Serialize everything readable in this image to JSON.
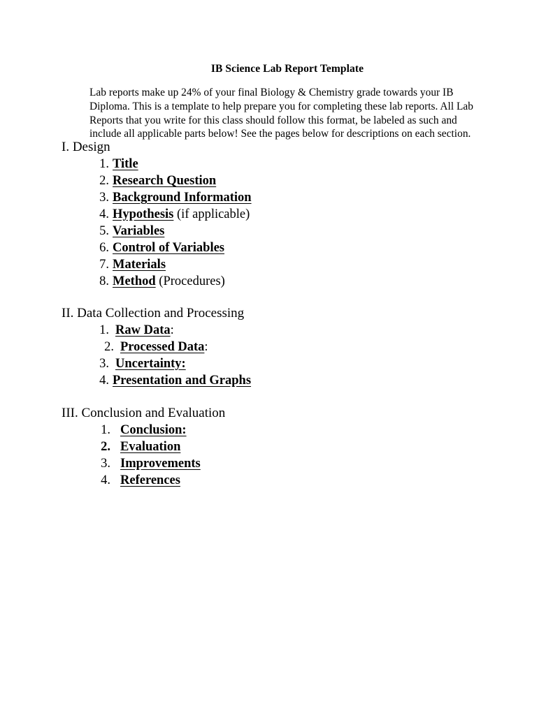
{
  "document": {
    "title": "IB Science Lab Report Template",
    "intro_paragraph": "Lab reports make up 24% of your final Biology & Chemistry grade towards your IB Diploma. This is a template to help prepare you for completing these lab reports. All Lab Reports that you write for this class should follow this format, be labeled as such and include all applicable parts below! See the pages below for descriptions on each section."
  },
  "sections": [
    {
      "heading": "I. Design",
      "items": [
        {
          "marker": "1.",
          "label": "Title",
          "suffix": ""
        },
        {
          "marker": "2.",
          "label": "Research Question",
          "suffix": ""
        },
        {
          "marker": "3.",
          "label": "Background Information",
          "suffix": ""
        },
        {
          "marker": "4.",
          "label": "Hypothesis",
          "suffix": " (if applicable)"
        },
        {
          "marker": "5.",
          "label": "Variables",
          "suffix": ""
        },
        {
          "marker": "6.",
          "label": "Control of Variables",
          "suffix": ""
        },
        {
          "marker": "7.",
          "label": "Materials",
          "suffix": ""
        },
        {
          "marker": "8.",
          "label": "Method",
          "suffix": " (Procedures)"
        }
      ]
    },
    {
      "heading": "II. Data Collection and Processing",
      "items": [
        {
          "marker": "1.",
          "label": "Raw Data",
          "suffix": ":"
        },
        {
          "marker": "2.",
          "label": "Processed Data",
          "suffix": ":"
        },
        {
          "marker": "3.",
          "label": "Uncertainty:",
          "suffix": ""
        },
        {
          "marker": "4.",
          "label": "Presentation and Graphs",
          "suffix": ""
        }
      ]
    },
    {
      "heading": "III. Conclusion and Evaluation",
      "items": [
        {
          "marker": "1.",
          "label": "Conclusion:",
          "suffix": ""
        },
        {
          "marker": "2.",
          "label": "Evaluation",
          "suffix": ""
        },
        {
          "marker": "3.",
          "label": "Improvements",
          "suffix": ""
        },
        {
          "marker": "4.",
          "label": "References",
          "suffix": ""
        }
      ]
    }
  ]
}
